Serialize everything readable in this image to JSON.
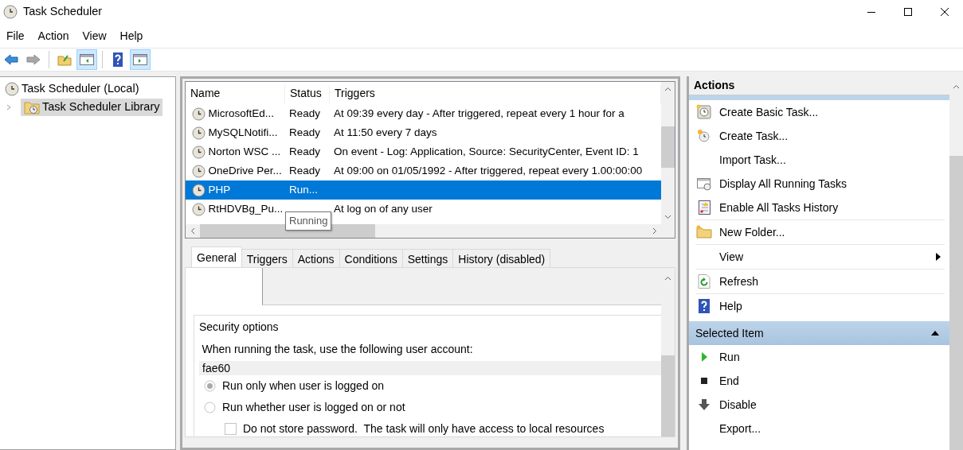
{
  "window": {
    "title": "Task Scheduler"
  },
  "menu": [
    "File",
    "Action",
    "View",
    "Help"
  ],
  "toolbar": [
    {
      "kind": "back",
      "disabled": false,
      "pressed": false
    },
    {
      "kind": "forward",
      "disabled": true,
      "pressed": false
    },
    {
      "kind": "folder",
      "disabled": false,
      "pressed": false
    },
    {
      "kind": "tree-pane",
      "disabled": false,
      "pressed": true
    },
    {
      "kind": "help",
      "disabled": false,
      "pressed": false
    },
    {
      "kind": "action-pane",
      "disabled": false,
      "pressed": true
    }
  ],
  "tree": [
    {
      "label": "Task Scheduler (Local)",
      "selected": false,
      "children": [
        {
          "label": "Task Scheduler Library",
          "selected": true,
          "expanded": false
        }
      ]
    }
  ],
  "task_list": {
    "columns": [
      "Name",
      "Status",
      "Triggers"
    ],
    "rows": [
      {
        "name": "MicrosoftEd...",
        "status": "Ready",
        "trigger": "At 09:39 every day - After triggered, repeat every 1 hour for a",
        "selected": false
      },
      {
        "name": "MySQLNotifi...",
        "status": "Ready",
        "trigger": "At 11:50 every 7 days",
        "selected": false
      },
      {
        "name": "Norton WSC ...",
        "status": "Ready",
        "trigger": "On event - Log: Application, Source: SecurityCenter, Event ID: 1",
        "selected": false
      },
      {
        "name": "OneDrive Per...",
        "status": "Ready",
        "trigger": "At 09:00 on 01/05/1992 - After triggered, repeat every 1.00:00:00",
        "selected": false
      },
      {
        "name": "PHP",
        "status": "Run...",
        "selected": true
      },
      {
        "name": "RtHDVBg_Pu...",
        "trigger": "At log on of any user",
        "selected": false
      }
    ],
    "tooltip": "Running"
  },
  "tabs": [
    {
      "label": "General",
      "selected": true
    },
    {
      "label": "Triggers",
      "selected": false
    },
    {
      "label": "Actions",
      "selected": false
    },
    {
      "label": "Conditions",
      "selected": false
    },
    {
      "label": "Settings",
      "selected": false
    },
    {
      "label": "History (disabled)",
      "selected": false
    }
  ],
  "general": {
    "group_title": "Security options",
    "account_label": "When running the task, use the following user account:",
    "account": "fae60",
    "options": [
      {
        "kind": "radio",
        "label": "Run only when user is logged on",
        "selected": true
      },
      {
        "kind": "radio",
        "label": "Run whether user is logged on or not",
        "selected": false
      },
      {
        "kind": "checkbox",
        "label": "Do not store password.  The task will only have access to local resources",
        "checked": false
      }
    ]
  },
  "actions_pane": {
    "title": "Actions",
    "items": [
      {
        "label": "Create Basic Task...",
        "kind": "basic-task",
        "separator_after": false
      },
      {
        "label": "Create Task...",
        "kind": "task",
        "separator_after": false
      },
      {
        "label": "Import Task...",
        "kind": "plain",
        "separator_after": false
      },
      {
        "label": "Display All Running Tasks",
        "kind": "running",
        "separator_after": false
      },
      {
        "label": "Enable All Tasks History",
        "kind": "history",
        "separator_after": true
      },
      {
        "label": "New Folder...",
        "kind": "folder",
        "separator_after": true
      },
      {
        "label": "View",
        "kind": "plain",
        "submenu": true,
        "separator_after": true
      },
      {
        "label": "Refresh",
        "kind": "refresh",
        "separator_after": true
      },
      {
        "label": "Help",
        "kind": "help",
        "separator_after": false
      }
    ],
    "section": {
      "title": "Selected Item",
      "expanded": true,
      "items": [
        {
          "label": "Run",
          "kind": "run"
        },
        {
          "label": "End",
          "kind": "end"
        },
        {
          "label": "Disable",
          "kind": "disable"
        },
        {
          "label": "Export...",
          "kind": "plain"
        }
      ]
    }
  }
}
